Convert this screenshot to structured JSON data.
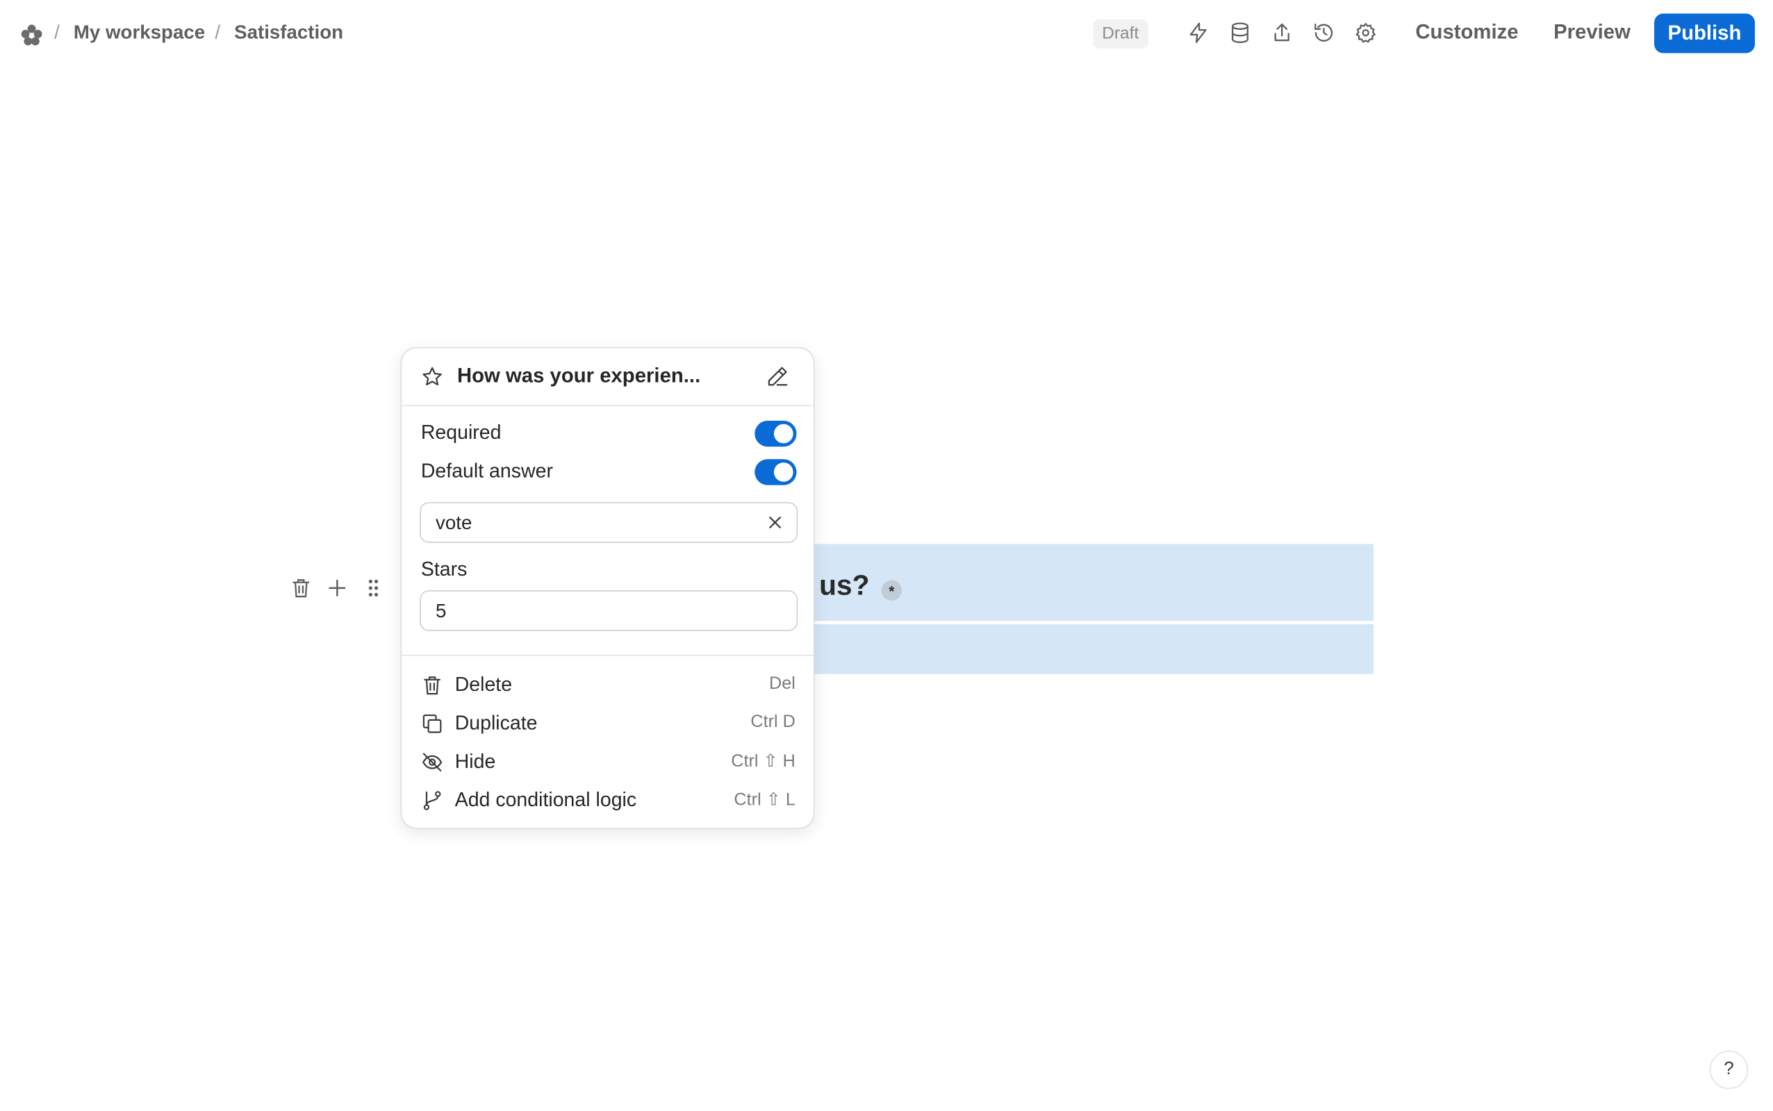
{
  "breadcrumb": {
    "separator": "/",
    "items": [
      "My workspace",
      "Satisfaction"
    ]
  },
  "header": {
    "status_badge": "Draft",
    "icons": [
      "lightning-icon",
      "database-icon",
      "share-icon",
      "history-icon",
      "settings-icon"
    ],
    "customize_label": "Customize",
    "preview_label": "Preview",
    "publish_label": "Publish",
    "accent_color": "#0a6bd6"
  },
  "block": {
    "question_visible_text": "us?",
    "required_mark": "*",
    "highlight_color": "#d5e6f7"
  },
  "popover": {
    "title": "How was your experien...",
    "required_label": "Required",
    "required_on": true,
    "default_answer_label": "Default answer",
    "default_answer_on": true,
    "default_answer_value": "vote",
    "stars_label": "Stars",
    "stars_value": "5",
    "menu": [
      {
        "label": "Delete",
        "shortcut": "Del",
        "icon": "trash-icon"
      },
      {
        "label": "Duplicate",
        "shortcut": "Ctrl D",
        "icon": "copy-icon"
      },
      {
        "label": "Hide",
        "shortcut": "Ctrl ⇧ H",
        "icon": "eye-off-icon"
      },
      {
        "label": "Add conditional logic",
        "shortcut": "Ctrl ⇧ L",
        "icon": "branch-icon"
      }
    ]
  },
  "help": {
    "label": "?"
  }
}
